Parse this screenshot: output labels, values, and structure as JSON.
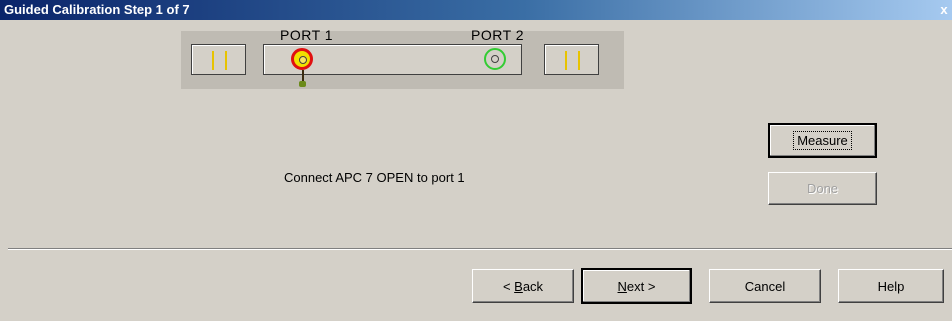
{
  "window": {
    "title": "Guided Calibration Step 1 of 7",
    "close_glyph": "x"
  },
  "diagram": {
    "port1_label": "PORT 1",
    "port2_label": "PORT 2",
    "active_port_color": "#f0e000",
    "inactive_port_color": "#33cc33"
  },
  "instruction": "Connect APC 7  OPEN to port 1",
  "buttons": {
    "measure": "Measure",
    "done": "Done",
    "back_prefix": "< ",
    "back_accel": "B",
    "back_rest": "ack",
    "next_accel": "N",
    "next_rest": "ext >",
    "cancel": "Cancel",
    "help": "Help"
  }
}
